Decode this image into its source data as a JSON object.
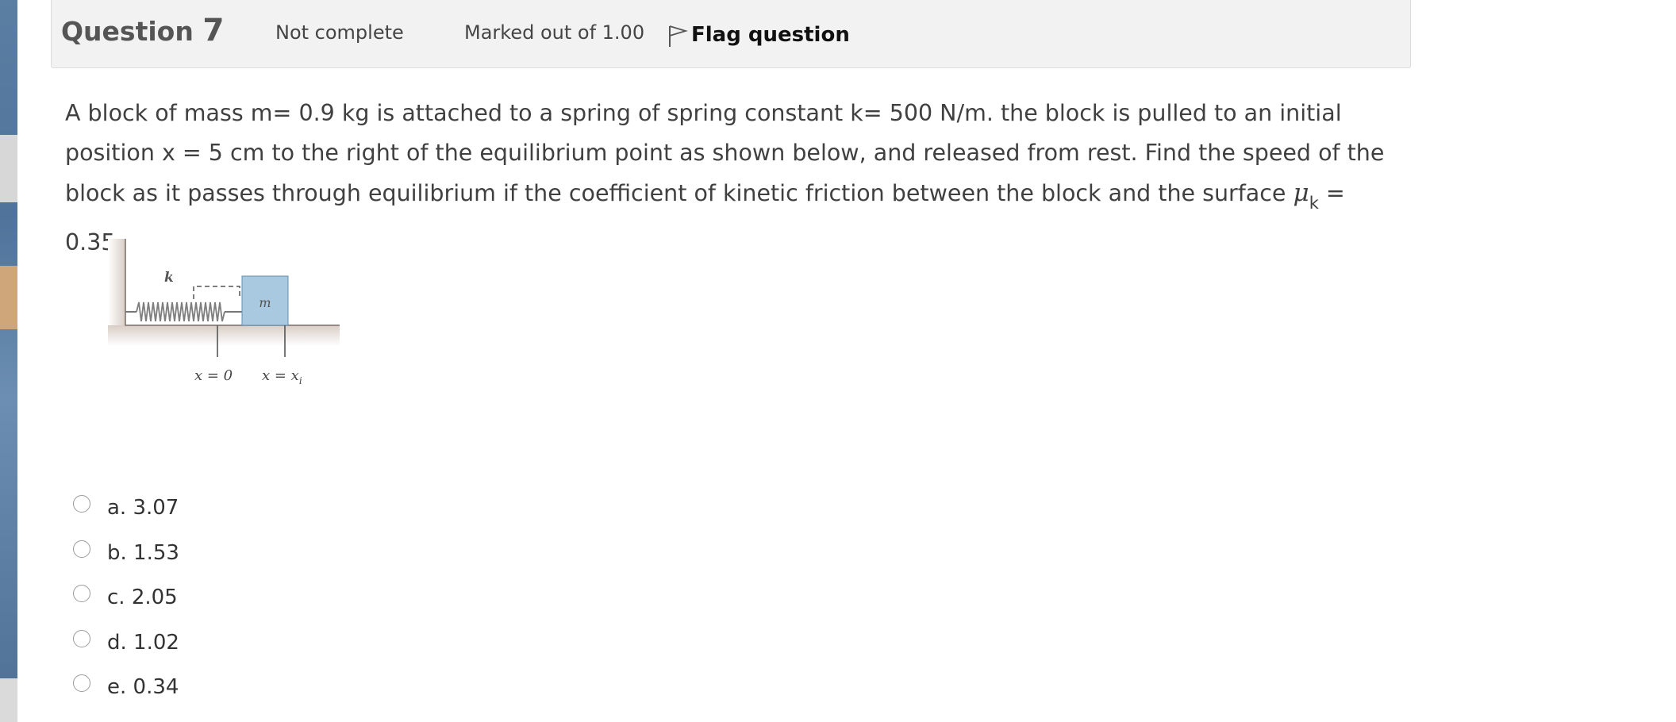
{
  "question": {
    "label": "Question",
    "number": "7",
    "state": "Not complete",
    "grade": "Marked out of 1.00",
    "flag_label": "Flag question"
  },
  "question_text": {
    "main": "A block of mass m= 0.9 kg is attached to a spring of spring constant k= 500 N/m. the block is pulled to an initial position x = 5 cm to the right of the equilibrium point as shown below, and released from rest. Find the speed of the block as it passes through equilibrium if the coefficient of kinetic friction between the block and the surface ",
    "mu_symbol": "μ",
    "mu_subscript": "k",
    "tail": " = 0.35."
  },
  "figure": {
    "spring_label": "k",
    "mass_label": "m",
    "label_x0": "x = 0",
    "label_xi_prefix": "x = x",
    "label_xi_sub": "i"
  },
  "answers": [
    {
      "label": "a. 3.07"
    },
    {
      "label": "b. 1.53"
    },
    {
      "label": "c. 2.05"
    },
    {
      "label": "d. 1.02"
    },
    {
      "label": "e. 0.34"
    }
  ],
  "colors": {
    "header_bg": "#f2f2f2",
    "block_fill": "#a9c9e0",
    "floor_fill": "#e6dcd6"
  }
}
